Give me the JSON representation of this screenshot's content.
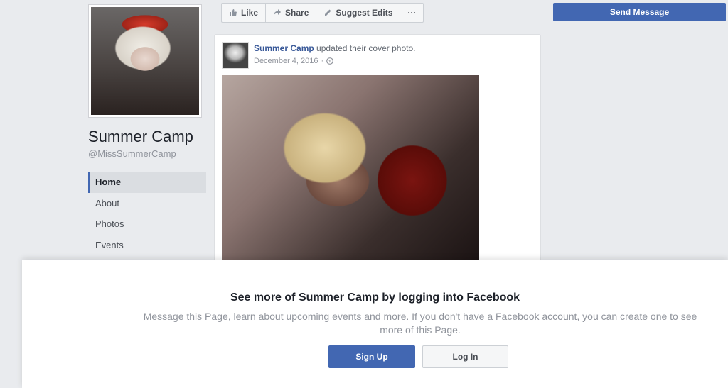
{
  "profile": {
    "name": "Summer Camp",
    "handle": "@MissSummerCamp"
  },
  "sidebar": {
    "items": [
      {
        "label": "Home"
      },
      {
        "label": "About"
      },
      {
        "label": "Photos"
      },
      {
        "label": "Events"
      }
    ]
  },
  "actions": {
    "like_label": "Like",
    "share_label": "Share",
    "suggest_label": "Suggest Edits",
    "more_label": "···",
    "send_message_label": "Send Message"
  },
  "post": {
    "author": "Summer Camp",
    "action_text": "updated their cover photo.",
    "date": "December 4, 2016",
    "separator": "·"
  },
  "login_prompt": {
    "title": "See more of Summer Camp by logging into Facebook",
    "message": "Message this Page, learn about upcoming events and more. If you don't have a Facebook account, you can create one to see more of this Page.",
    "signup_label": "Sign Up",
    "login_label": "Log In"
  },
  "colors": {
    "brand_blue": "#4267b2",
    "background": "#e9ebee",
    "link_blue": "#385898"
  },
  "icons": [
    "like-icon",
    "share-icon",
    "pencil-icon",
    "globe-icon"
  ]
}
